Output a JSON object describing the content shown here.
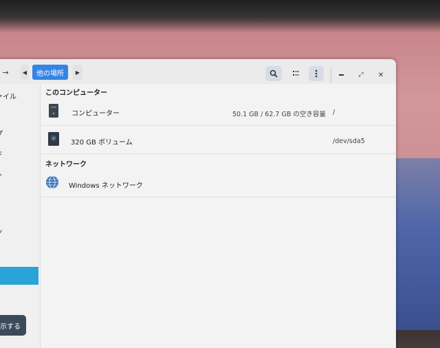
{
  "window": {
    "breadcrumb": "他の場所",
    "icons": [
      "forward-arrow",
      "chevron-left",
      "chevron-right",
      "search",
      "view-list",
      "menu-dots",
      "minimize",
      "maximize",
      "close"
    ]
  },
  "sidebar": {
    "items": [
      {
        "label": "ァイル"
      },
      {
        "label": "プ"
      },
      {
        "label": "ド"
      },
      {
        "label": "ト"
      },
      {
        "label": "ッ"
      }
    ],
    "action_button": "示する"
  },
  "main": {
    "section_computer": "このコンピューター",
    "section_network": "ネットワーク",
    "items": [
      {
        "name": "コンピューター",
        "info": "50.1 GB / 62.7 GB の空き容量",
        "path": "/"
      },
      {
        "name": "320 GB ボリューム",
        "info": "",
        "path": "/dev/sda5"
      },
      {
        "name": "Windows ネットワーク",
        "info": "",
        "path": ""
      }
    ]
  },
  "colors": {
    "accent": "#3584e4",
    "sidebar_selection": "#29a3d8",
    "window_bg": "#f3f3f4"
  }
}
